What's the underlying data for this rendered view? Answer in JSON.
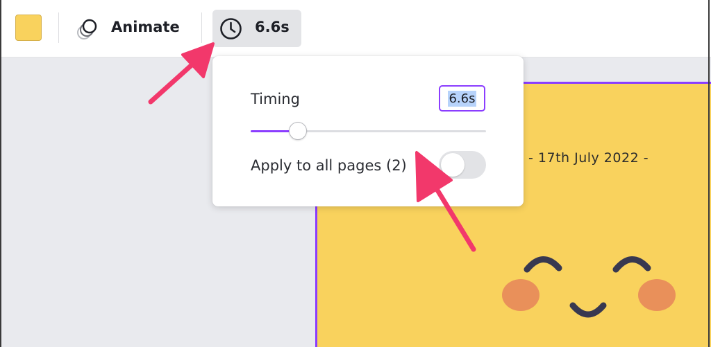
{
  "toolbar": {
    "swatch_color": "#f9d25d",
    "animate_label": "Animate",
    "animate_icon": "animate-layers-icon",
    "timing_button_label": "6.6s",
    "timing_icon": "clock-icon"
  },
  "popover": {
    "timing_label": "Timing",
    "timing_value": "6.6s",
    "slider_fraction": 0.2,
    "apply_label": "Apply to all pages (2)",
    "apply_toggle_on": false
  },
  "design": {
    "date_text": "- 17th July 2022 -",
    "background_color": "#f9d25d",
    "border_color": "#8b3dff"
  },
  "annotations": {
    "arrow_color": "#f2386b",
    "arrows": [
      "arrow-to-timing-button",
      "arrow-to-apply-toggle"
    ]
  },
  "colors": {
    "accent": "#8b3dff",
    "selection": "#b7d3fb",
    "cheek": "#e9905a",
    "face_features": "#383850"
  }
}
